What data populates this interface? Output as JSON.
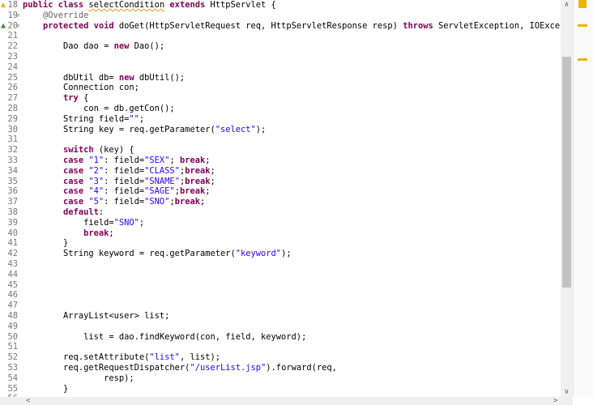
{
  "editor": {
    "lines": [
      {
        "n": "18",
        "parts": [
          [
            "kw",
            "public class "
          ],
          [
            "warn",
            "selectCondition"
          ],
          [
            "kw",
            " extends "
          ],
          [
            "plain",
            "HttpServlet {"
          ]
        ]
      },
      {
        "n": "19",
        "parts": [
          [
            "plain",
            "    "
          ],
          [
            "ann",
            "@Override"
          ]
        ]
      },
      {
        "n": "20",
        "parts": [
          [
            "plain",
            "    "
          ],
          [
            "kw",
            "protected void "
          ],
          [
            "plain",
            "doGet(HttpServletRequest req, HttpServletResponse resp) "
          ],
          [
            "kw",
            "throws "
          ],
          [
            "plain",
            "ServletException, IOException {"
          ]
        ]
      },
      {
        "n": "21",
        "parts": []
      },
      {
        "n": "22",
        "parts": [
          [
            "plain",
            "        Dao dao = "
          ],
          [
            "kw",
            "new "
          ],
          [
            "plain",
            "Dao();"
          ]
        ]
      },
      {
        "n": "23",
        "parts": []
      },
      {
        "n": "24",
        "parts": []
      },
      {
        "n": "25",
        "parts": [
          [
            "plain",
            "        dbUtil db= "
          ],
          [
            "kw",
            "new "
          ],
          [
            "plain",
            "dbUtil();"
          ]
        ]
      },
      {
        "n": "26",
        "parts": [
          [
            "plain",
            "        Connection con;"
          ]
        ]
      },
      {
        "n": "27",
        "parts": [
          [
            "plain",
            "        "
          ],
          [
            "kw",
            "try "
          ],
          [
            "plain",
            "{"
          ]
        ]
      },
      {
        "n": "28",
        "parts": [
          [
            "plain",
            "            con = db.getCon();"
          ]
        ]
      },
      {
        "n": "29",
        "parts": [
          [
            "plain",
            "        String field="
          ],
          [
            "str",
            "\"\""
          ],
          [
            "plain",
            ";"
          ]
        ]
      },
      {
        "n": "30",
        "parts": [
          [
            "plain",
            "        String key = req.getParameter("
          ],
          [
            "str",
            "\"select\""
          ],
          [
            "plain",
            ");"
          ]
        ]
      },
      {
        "n": "31",
        "parts": []
      },
      {
        "n": "32",
        "parts": [
          [
            "plain",
            "        "
          ],
          [
            "kw",
            "switch "
          ],
          [
            "plain",
            "(key) {"
          ]
        ]
      },
      {
        "n": "33",
        "parts": [
          [
            "plain",
            "        "
          ],
          [
            "kw",
            "case "
          ],
          [
            "str",
            "\"1\""
          ],
          [
            "plain",
            ": field="
          ],
          [
            "str",
            "\"SEX\""
          ],
          [
            "plain",
            "; "
          ],
          [
            "kw",
            "break"
          ],
          [
            "plain",
            ";"
          ]
        ]
      },
      {
        "n": "34",
        "parts": [
          [
            "plain",
            "        "
          ],
          [
            "kw",
            "case "
          ],
          [
            "str",
            "\"2\""
          ],
          [
            "plain",
            ": field="
          ],
          [
            "str",
            "\"CLASS\""
          ],
          [
            "plain",
            ";"
          ],
          [
            "kw",
            "break"
          ],
          [
            "plain",
            ";"
          ]
        ]
      },
      {
        "n": "35",
        "parts": [
          [
            "plain",
            "        "
          ],
          [
            "kw",
            "case "
          ],
          [
            "str",
            "\"3\""
          ],
          [
            "plain",
            ": field="
          ],
          [
            "str",
            "\"SNAME\""
          ],
          [
            "plain",
            ";"
          ],
          [
            "kw",
            "break"
          ],
          [
            "plain",
            ";"
          ]
        ]
      },
      {
        "n": "36",
        "parts": [
          [
            "plain",
            "        "
          ],
          [
            "kw",
            "case "
          ],
          [
            "str",
            "\"4\""
          ],
          [
            "plain",
            ": field="
          ],
          [
            "str",
            "\"SAGE\""
          ],
          [
            "plain",
            ";"
          ],
          [
            "kw",
            "break"
          ],
          [
            "plain",
            ";"
          ]
        ]
      },
      {
        "n": "37",
        "parts": [
          [
            "plain",
            "        "
          ],
          [
            "kw",
            "case "
          ],
          [
            "str",
            "\"5\""
          ],
          [
            "plain",
            ": field="
          ],
          [
            "str",
            "\"SNO\""
          ],
          [
            "plain",
            ";"
          ],
          [
            "kw",
            "break"
          ],
          [
            "plain",
            ";"
          ]
        ]
      },
      {
        "n": "38",
        "parts": [
          [
            "plain",
            "        "
          ],
          [
            "kw",
            "default"
          ],
          [
            "plain",
            ":"
          ]
        ]
      },
      {
        "n": "39",
        "parts": [
          [
            "plain",
            "            field="
          ],
          [
            "str",
            "\"SNO\""
          ],
          [
            "plain",
            ";"
          ]
        ]
      },
      {
        "n": "40",
        "parts": [
          [
            "plain",
            "            "
          ],
          [
            "kw",
            "break"
          ],
          [
            "plain",
            ";"
          ]
        ]
      },
      {
        "n": "41",
        "parts": [
          [
            "plain",
            "        }"
          ]
        ]
      },
      {
        "n": "42",
        "parts": [
          [
            "plain",
            "        String keyword = req.getParameter("
          ],
          [
            "str",
            "\"keyword\""
          ],
          [
            "plain",
            ");"
          ]
        ]
      },
      {
        "n": "43",
        "parts": []
      },
      {
        "n": "44",
        "parts": []
      },
      {
        "n": "45",
        "parts": []
      },
      {
        "n": "46",
        "parts": []
      },
      {
        "n": "47",
        "parts": []
      },
      {
        "n": "48",
        "parts": [
          [
            "plain",
            "        ArrayList<user> list;"
          ]
        ]
      },
      {
        "n": "49",
        "parts": []
      },
      {
        "n": "50",
        "parts": [
          [
            "plain",
            "            list = dao.findKeyword(con, field, keyword);"
          ]
        ]
      },
      {
        "n": "51",
        "parts": []
      },
      {
        "n": "52",
        "parts": [
          [
            "plain",
            "        req.setAttribute("
          ],
          [
            "str",
            "\"list\""
          ],
          [
            "plain",
            ", list);"
          ]
        ]
      },
      {
        "n": "53",
        "parts": [
          [
            "plain",
            "        req.getRequestDispatcher("
          ],
          [
            "str",
            "\"/userList.jsp\""
          ],
          [
            "plain",
            ").forward(req,"
          ]
        ]
      },
      {
        "n": "54",
        "parts": [
          [
            "plain",
            "                resp);"
          ]
        ]
      },
      {
        "n": "55",
        "parts": [
          [
            "plain",
            "        }"
          ]
        ]
      },
      {
        "n": "56",
        "parts": []
      }
    ],
    "fold_markers": {
      "19": "⊖",
      "20": "⊖"
    },
    "warning_line": "18",
    "override_line": "20"
  },
  "scrollbars": {
    "up_arrow": "∧",
    "down_arrow": "∨",
    "left_arrow": "<",
    "right_arrow": ">"
  },
  "colors": {
    "keyword": "#7f0055",
    "string": "#2a00ff",
    "annotation": "#646464",
    "warning": "#e6b800"
  }
}
